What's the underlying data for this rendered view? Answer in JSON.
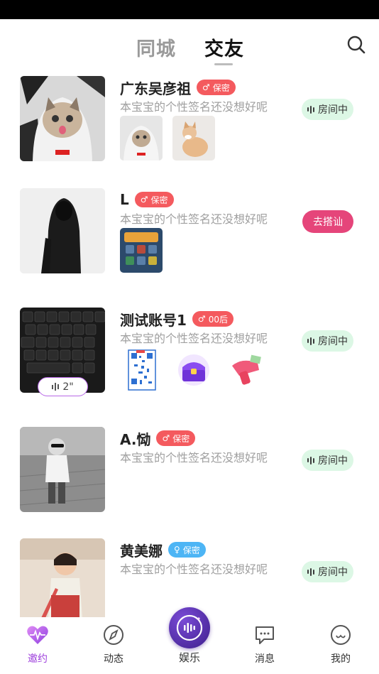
{
  "header": {
    "tabs": [
      {
        "label": "同城",
        "active": false
      },
      {
        "label": "交友",
        "active": true
      }
    ],
    "search_icon": "search-icon"
  },
  "users": [
    {
      "name": "广东吴彦祖",
      "gender": "male",
      "tag": "保密",
      "signature": "本宝宝的个性签名还没想好呢",
      "action": "房间中",
      "photo_count": 2
    },
    {
      "name": "L",
      "gender": "male",
      "tag": "保密",
      "signature": "本宝宝的个性签名还没想好呢",
      "action": "去搭讪",
      "photo_count": 1
    },
    {
      "name": "测试账号1",
      "gender": "male",
      "tag": "00后",
      "signature": "本宝宝的个性签名还没想好呢",
      "action": "房间中",
      "voice_duration": "2\"",
      "photo_count": 3
    },
    {
      "name": "A.恸",
      "gender": "male",
      "tag": "保密",
      "signature": "本宝宝的个性签名还没想好呢",
      "action": "房间中",
      "photo_count": 0
    },
    {
      "name": "黄美娜",
      "gender": "female",
      "tag": "保密",
      "signature": "本宝宝的个性签名还没想好呢",
      "action": "房间中",
      "photo_count": 0
    }
  ],
  "tabbar": {
    "items": [
      {
        "label": "邀约",
        "icon": "heart-wave-icon",
        "active": true
      },
      {
        "label": "动态",
        "icon": "compass-icon",
        "active": false
      },
      {
        "label": "娱乐",
        "icon": "voice-room-icon",
        "active": false
      },
      {
        "label": "消息",
        "icon": "chat-bubble-icon",
        "active": false
      },
      {
        "label": "我的",
        "icon": "face-icon",
        "active": false
      }
    ]
  },
  "colors": {
    "male_tag": "#f45a5e",
    "female_tag": "#4db5f5",
    "in_room_pill": "#dcf7e5",
    "chat_pill": "#e5457a",
    "active_tab": "#9d3fdc"
  }
}
